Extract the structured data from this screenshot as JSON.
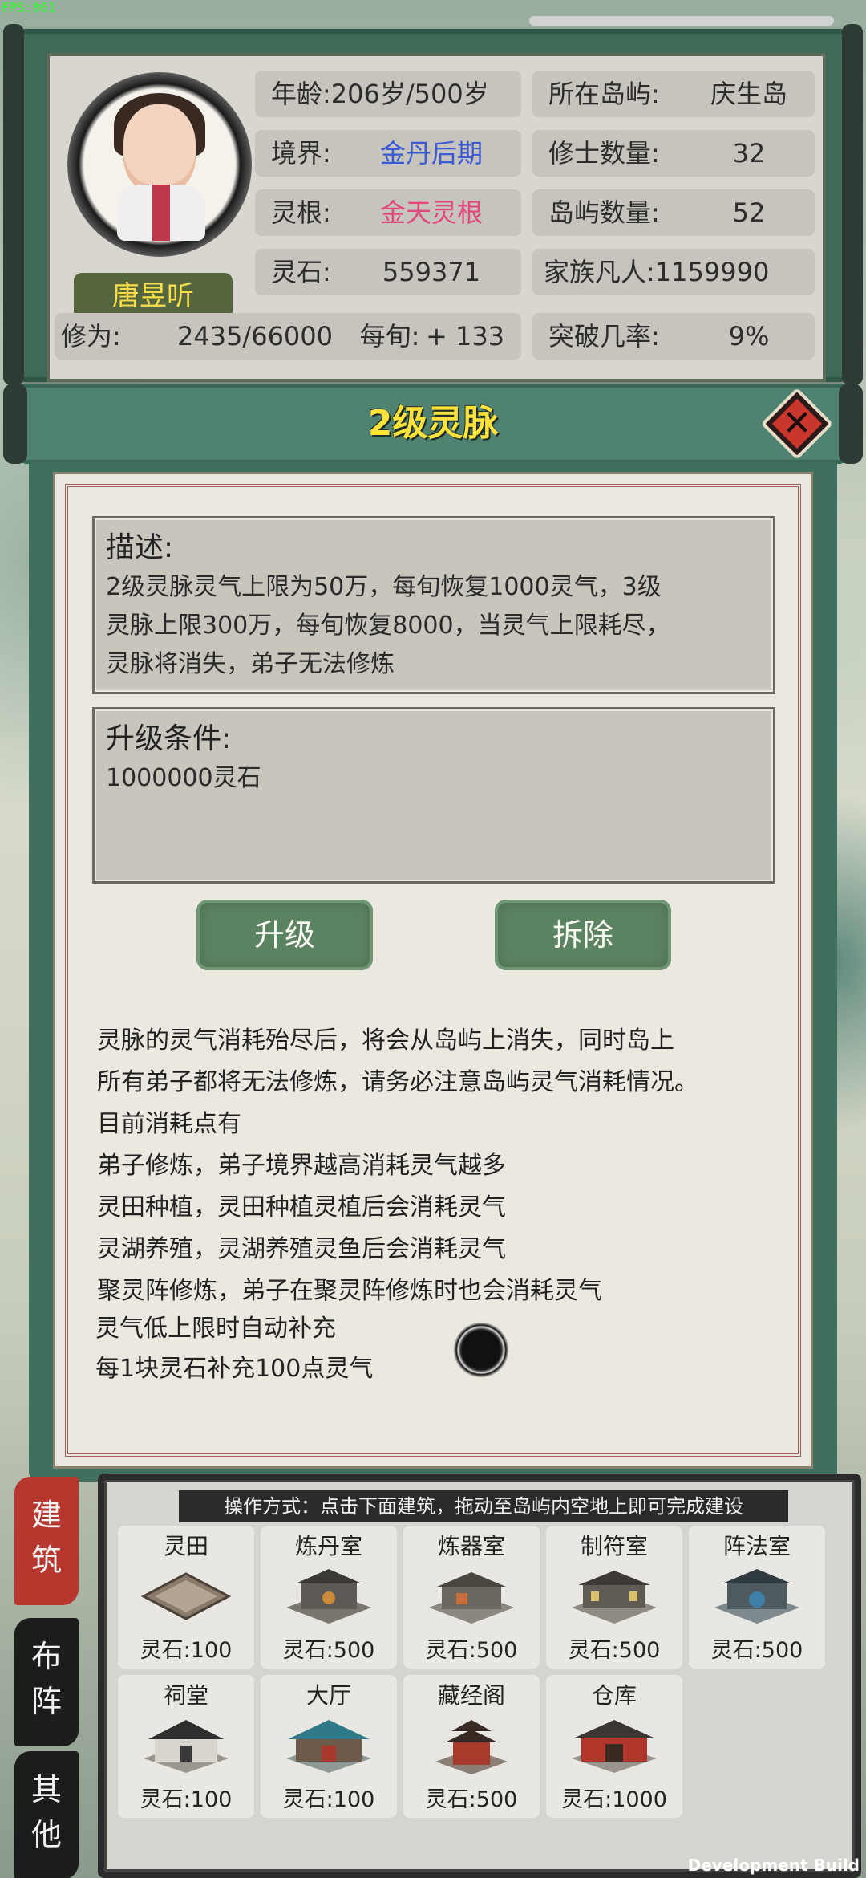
{
  "fps": "FPS:861",
  "status": {
    "name": "唐昱听",
    "age_label": "年龄:",
    "age_value": "206岁/500岁",
    "realm_label": "境界:",
    "realm_value": "金丹后期",
    "root_label": "灵根:",
    "root_value": "金天灵根",
    "stones_label": "灵石:",
    "stones_value": "559371",
    "cultivation_label": "修为:",
    "cultivation_value": "2435/66000",
    "per_turn_label": "每旬:",
    "per_turn_value": "+ 133",
    "island_label": "所在岛屿:",
    "island_value": "庆生岛",
    "cultivators_label": "修士数量:",
    "cultivators_value": "32",
    "islands_label": "岛屿数量:",
    "islands_value": "52",
    "mortals_label": "家族凡人:",
    "mortals_value": "1159990",
    "breakthrough_label": "突破几率:",
    "breakthrough_value": "9%"
  },
  "dialog": {
    "title": "2级灵脉",
    "close_glyph": "✕",
    "description_head": "描述:",
    "description_lines": [
      "2级灵脉灵气上限为50万，每旬恢复1000灵气，3级",
      "灵脉上限300万，每旬恢复8000，当灵气上限耗尽，",
      "灵脉将消失，弟子无法修炼"
    ],
    "upgrade_head": "升级条件:",
    "upgrade_text": "1000000灵石",
    "upgrade_button": "升级",
    "demolish_button": "拆除",
    "notes": [
      "灵脉的灵气消耗殆尽后，将会从岛屿上消失，同时岛上",
      "所有弟子都将无法修炼，请务必注意岛屿灵气消耗情况。",
      "目前消耗点有",
      "弟子修炼，弟子境界越高消耗灵气越多",
      "灵田种植，灵田种植灵植后会消耗灵气",
      "灵湖养殖，灵湖养殖灵鱼后会消耗灵气",
      "聚灵阵修炼，弟子在聚灵阵修炼时也会消耗灵气"
    ],
    "auto_lines": [
      "灵气低上限时自动补充",
      "每1块灵石补充100点灵气"
    ]
  },
  "build": {
    "hint": "操作方式：点击下面建筑，拖动至岛屿内空地上即可完成建设",
    "items": [
      {
        "name": "灵田",
        "cost": "灵石:100"
      },
      {
        "name": "炼丹室",
        "cost": "灵石:500"
      },
      {
        "name": "炼器室",
        "cost": "灵石:500"
      },
      {
        "name": "制符室",
        "cost": "灵石:500"
      },
      {
        "name": "阵法室",
        "cost": "灵石:500"
      },
      {
        "name": "祠堂",
        "cost": "灵石:100"
      },
      {
        "name": "大厅",
        "cost": "灵石:100"
      },
      {
        "name": "藏经阁",
        "cost": "灵石:500"
      },
      {
        "name": "仓库",
        "cost": "灵石:1000"
      }
    ]
  },
  "side_tabs": [
    {
      "l1": "建",
      "l2": "筑"
    },
    {
      "l1": "布",
      "l2": "阵"
    },
    {
      "l1": "其",
      "l2": "他"
    }
  ],
  "dev_build": "Development Build",
  "colors": {
    "title_yellow": "#ffe23a",
    "realm_blue": "#3a5bd6",
    "root_pink": "#e2477e",
    "button_green": "#5c8361",
    "tab_active_red": "#b7372f"
  }
}
